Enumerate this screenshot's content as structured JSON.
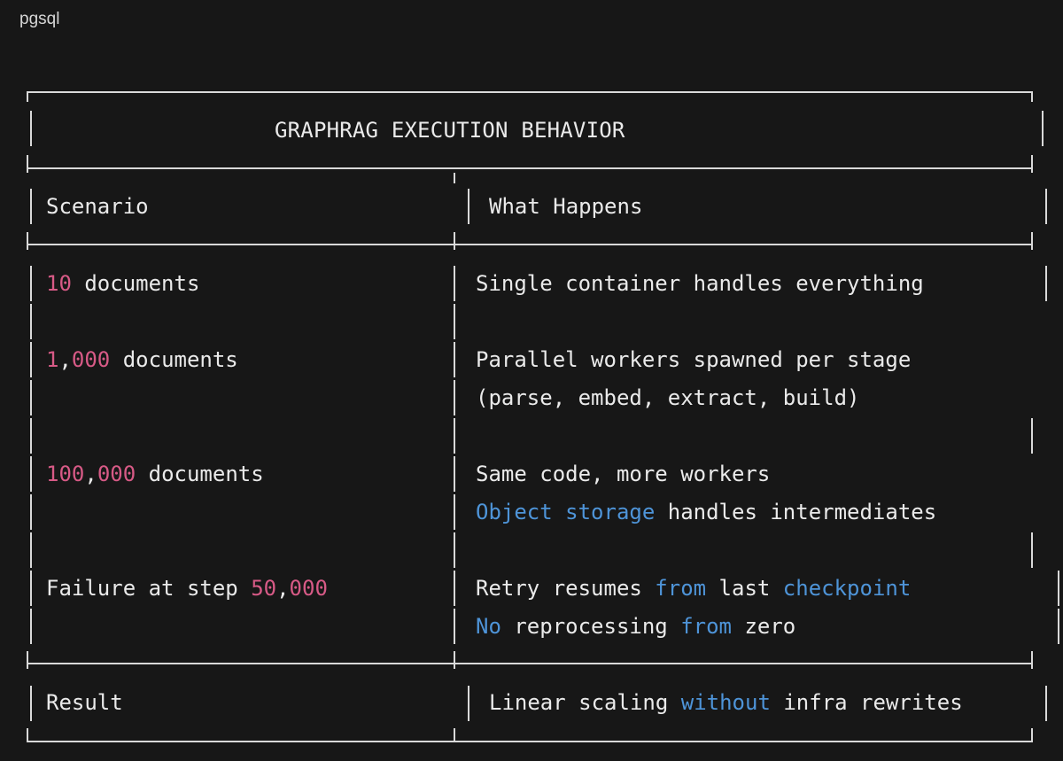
{
  "language_label": "pgsql",
  "table": {
    "title": "GRAPHRAG EXECUTION BEHAVIOR",
    "headers": {
      "scenario": "Scenario",
      "what_happens": "What Happens"
    },
    "rows": [
      {
        "scenario_num": "10",
        "scenario_rest": " documents",
        "what": [
          "Single container handles everything"
        ]
      },
      {
        "scenario_num_a": "1",
        "scenario_num_sep": ",",
        "scenario_num_b": "000",
        "scenario_rest": " documents",
        "what": [
          "Parallel workers spawned per stage",
          "(parse, embed, extract, build)"
        ]
      },
      {
        "scenario_num_a": "100",
        "scenario_num_sep": ",",
        "scenario_num_b": "000",
        "scenario_rest": " documents",
        "what_line1": "Same code, more workers",
        "what_line2_kw": "Object storage",
        "what_line2_rest": " handles intermediates"
      },
      {
        "scenario_pre": "Failure at step ",
        "scenario_num_a": "50",
        "scenario_num_sep": ",",
        "scenario_num_b": "000",
        "what_line1_a": "Retry resumes ",
        "what_line1_kw1": "from",
        "what_line1_b": " last ",
        "what_line1_kw2": "checkpoint",
        "what_line2_kw1": "No",
        "what_line2_a": " reprocessing ",
        "what_line2_kw2": "from",
        "what_line2_b": " zero"
      }
    ],
    "result": {
      "label": "Result",
      "value_a": "Linear scaling ",
      "value_kw": "without",
      "value_b": " infra rewrites"
    }
  },
  "colors": {
    "background": "#171717",
    "text": "#eaeaea",
    "number": "#d75a86",
    "keyword": "#4e94d8",
    "border": "#d9d9d9"
  }
}
